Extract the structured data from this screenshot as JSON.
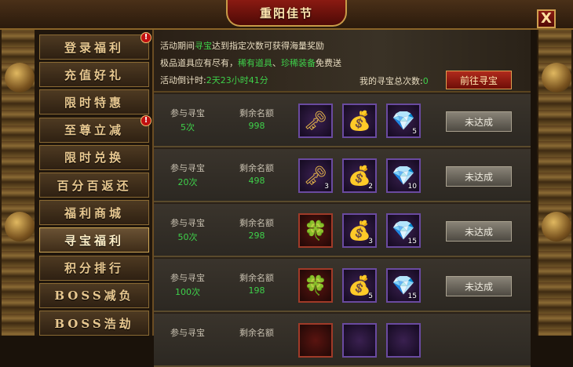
{
  "window": {
    "title": "重阳佳节",
    "close_symbol": "X"
  },
  "sidebar": {
    "items": [
      {
        "label": "登录福利",
        "badge": "!"
      },
      {
        "label": "充值好礼",
        "badge": ""
      },
      {
        "label": "限时特惠",
        "badge": ""
      },
      {
        "label": "至尊立减",
        "badge": "!"
      },
      {
        "label": "限时兑换",
        "badge": ""
      },
      {
        "label": "百分百返还",
        "badge": ""
      },
      {
        "label": "福利商城",
        "badge": ""
      },
      {
        "label": "寻宝福利",
        "badge": "",
        "active": true
      },
      {
        "label": "积分排行",
        "badge": ""
      },
      {
        "label": "BOSS减负",
        "badge": ""
      },
      {
        "label": "BOSS浩劫",
        "badge": ""
      }
    ]
  },
  "header": {
    "line1_pre": "活动期间",
    "line1_hl": "寻宝",
    "line1_post": "达到指定次数可获得海量奖励",
    "line2_pre": "极品道具应有尽有，",
    "line2_hl1": "稀有道具",
    "line2_sep": "、",
    "line2_hl2": "珍稀装备",
    "line2_post": "免费送",
    "countdown_label": "活动倒计时:",
    "countdown_value": "2天23小时41分",
    "total_label": "我的寻宝总次数:",
    "total_value": "0",
    "go_button": "前往寻宝"
  },
  "rows": [
    {
      "label1": "参与寻宝",
      "val1": "5次",
      "label2": "剩余名额",
      "val2": "998",
      "items": [
        {
          "icon": "key-icon",
          "glyph": "🗝",
          "count": "",
          "tone": "purple"
        },
        {
          "icon": "treasure-pile-icon",
          "glyph": "💰",
          "count": "",
          "tone": "purple"
        },
        {
          "icon": "crystal-icon",
          "glyph": "💎",
          "count": "5",
          "tone": "purple"
        }
      ],
      "status": "未达成"
    },
    {
      "label1": "参与寻宝",
      "val1": "20次",
      "label2": "剩余名额",
      "val2": "498",
      "items": [
        {
          "icon": "key-icon",
          "glyph": "🗝",
          "count": "3",
          "tone": "purple"
        },
        {
          "icon": "treasure-pile-icon",
          "glyph": "💰",
          "count": "2",
          "tone": "purple"
        },
        {
          "icon": "crystal-icon",
          "glyph": "💎",
          "count": "10",
          "tone": "purple"
        }
      ],
      "status": "未达成"
    },
    {
      "label1": "参与寻宝",
      "val1": "50次",
      "label2": "剩余名额",
      "val2": "298",
      "items": [
        {
          "icon": "green-orb-icon",
          "glyph": "🍀",
          "count": "",
          "tone": "red"
        },
        {
          "icon": "treasure-pile-icon",
          "glyph": "💰",
          "count": "3",
          "tone": "purple"
        },
        {
          "icon": "crystal-icon",
          "glyph": "💎",
          "count": "15",
          "tone": "purple"
        }
      ],
      "status": "未达成"
    },
    {
      "label1": "参与寻宝",
      "val1": "100次",
      "label2": "剩余名额",
      "val2": "198",
      "items": [
        {
          "icon": "green-orb-icon",
          "glyph": "🍀",
          "count": "",
          "tone": "red"
        },
        {
          "icon": "treasure-pile-icon",
          "glyph": "💰",
          "count": "5",
          "tone": "purple"
        },
        {
          "icon": "crystal-icon",
          "glyph": "💎",
          "count": "15",
          "tone": "purple"
        }
      ],
      "status": "未达成"
    },
    {
      "label1": "参与寻宝",
      "val1": "",
      "label2": "剩余名额",
      "val2": "",
      "items": [
        {
          "icon": "red-item-icon",
          "glyph": "",
          "count": "",
          "tone": "red"
        },
        {
          "icon": "treasure-pile-icon",
          "glyph": "",
          "count": "",
          "tone": "purple"
        },
        {
          "icon": "crystal-icon",
          "glyph": "",
          "count": "",
          "tone": "purple"
        }
      ],
      "status": ""
    }
  ]
}
